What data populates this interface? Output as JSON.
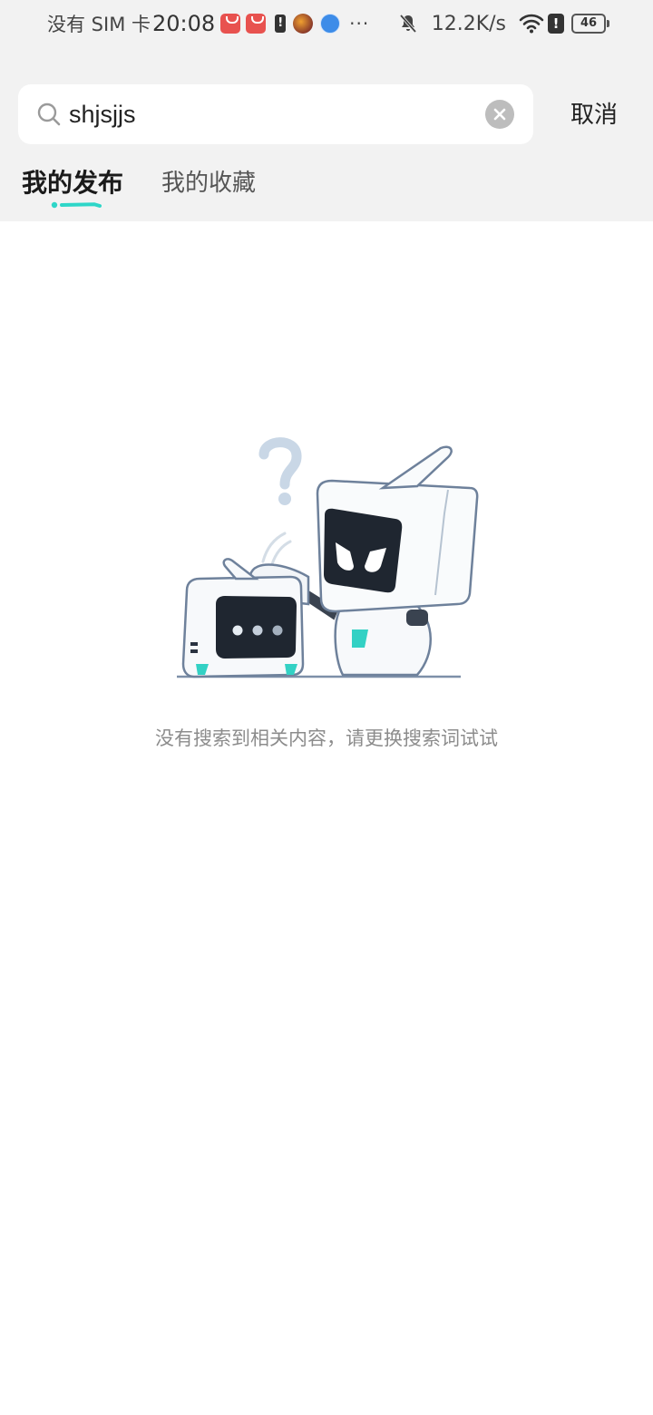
{
  "status_bar": {
    "carrier": "没有 SIM 卡",
    "time": "20:08",
    "notification_icons": [
      "huawei-appgallery-icon",
      "huawei-appgallery-icon",
      "alert-icon",
      "game-app-icon",
      "browser-app-icon"
    ],
    "more": "···",
    "network_speed": "12.2K/s",
    "battery_level": "46"
  },
  "search": {
    "query": "shjsjjs",
    "cancel_label": "取消"
  },
  "tabs": [
    {
      "label": "我的发布",
      "active": true
    },
    {
      "label": "我的收藏",
      "active": false
    }
  ],
  "empty_state": {
    "message": "没有搜索到相关内容，请更换搜索词试试"
  },
  "colors": {
    "accent": "#2ed6c8",
    "header_bg": "#f2f2f2",
    "muted_text": "#8c8c8c"
  }
}
